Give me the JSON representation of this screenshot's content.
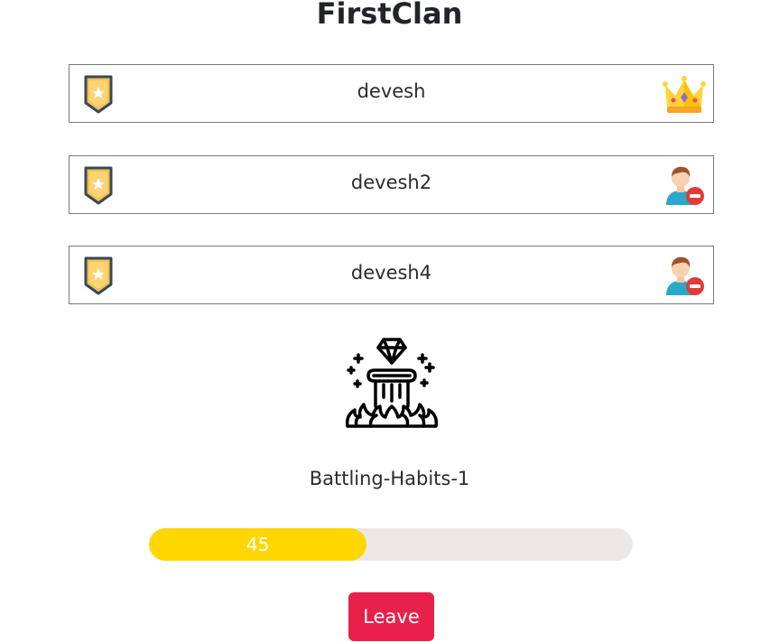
{
  "clan": {
    "title": "FirstClan"
  },
  "members": [
    {
      "name": "devesh",
      "badge_icon": "rank-badge-icon",
      "action_icon": "crown-icon",
      "role": "leader"
    },
    {
      "name": "devesh2",
      "badge_icon": "rank-badge-icon",
      "action_icon": "remove-user-icon",
      "role": "member"
    },
    {
      "name": "devesh4",
      "badge_icon": "rank-badge-icon",
      "action_icon": "remove-user-icon",
      "role": "member"
    }
  ],
  "challenge": {
    "icon": "diamond-trophy-icon",
    "name": "Battling-Habits-1",
    "progress_value": "45",
    "progress_fraction": 0.45
  },
  "actions": {
    "leave_label": "Leave"
  },
  "colors": {
    "progress_fill": "#ffd600",
    "progress_track": "#ebe8e6",
    "leave_button": "#e8204a"
  }
}
